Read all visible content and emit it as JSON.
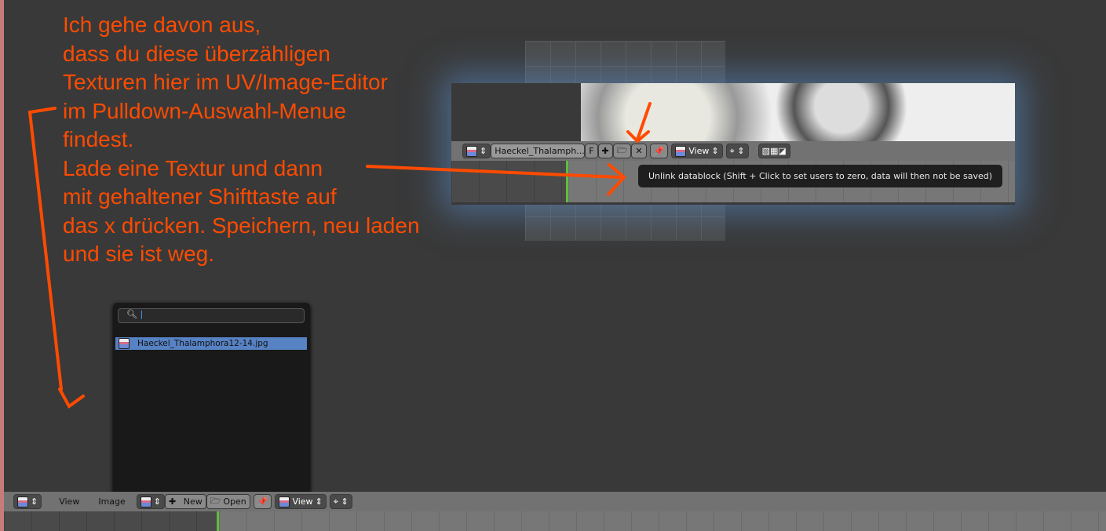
{
  "annotation": {
    "text": "Ich gehe davon aus,\ndass du diese überzähligen\nTexturen hier im UV/Image-Editor\nim Pulldown-Auswahl-Menue\nfindest.\nLade eine Textur und dann\nmit gehaltener Shifttaste auf\ndas x drücken. Speichern, neu laden\nund sie ist weg.",
    "color": "#ff4b00"
  },
  "inset": {
    "image_name": "Haeckel_Thalamph...",
    "fake_user": "F",
    "view_menu": "View",
    "tooltip": "Unlink datablock (Shift + Click to set users to zero, data will then not be saved)"
  },
  "popup": {
    "search_value": "",
    "item": "Haeckel_Thalamphora12-14.jpg"
  },
  "header": {
    "view": "View",
    "image": "Image",
    "new": "New",
    "open": "Open",
    "view_select": "View"
  }
}
